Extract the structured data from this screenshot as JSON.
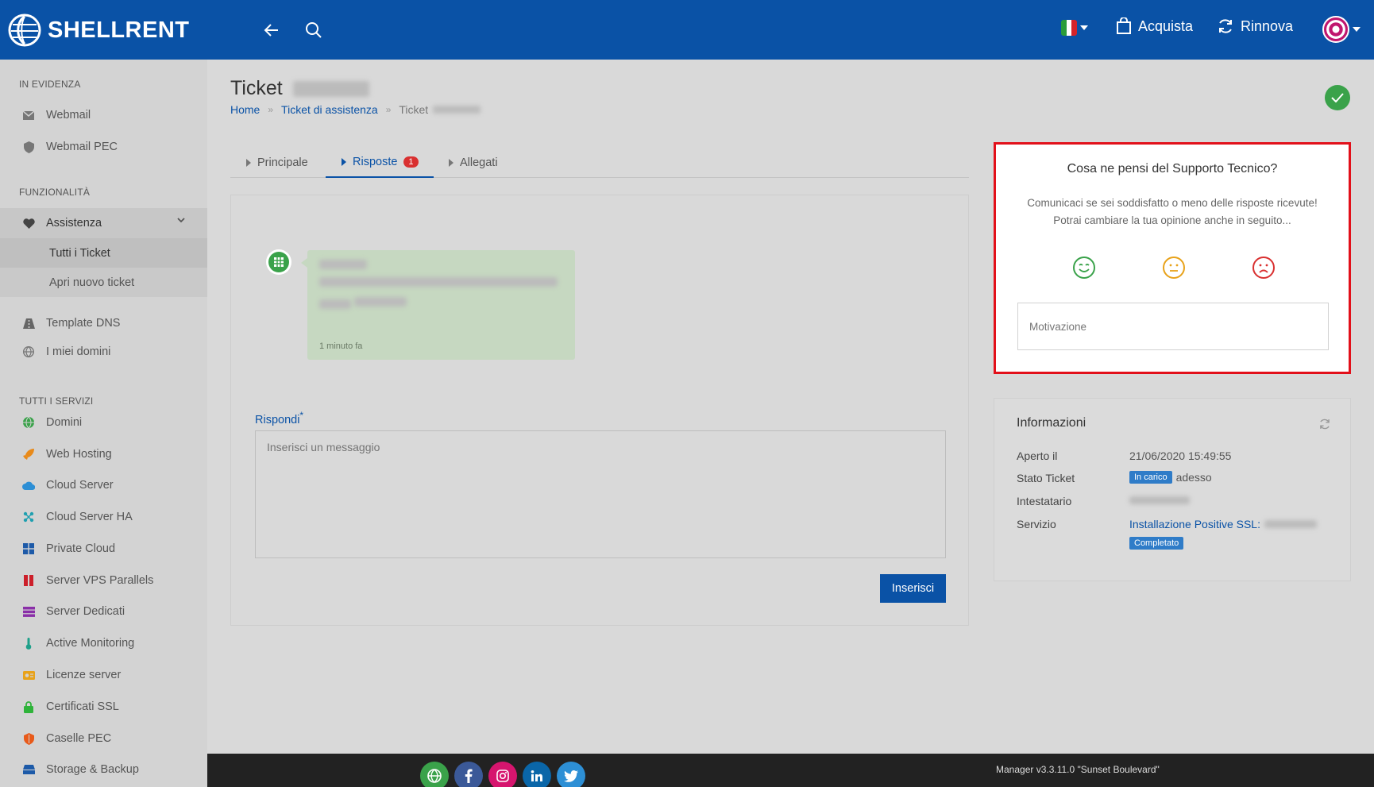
{
  "topbar": {
    "brand": "SHELLRENT",
    "buy_label": "Acquista",
    "renew_label": "Rinnova"
  },
  "sidebar": {
    "section_featured": "IN EVIDENZA",
    "webmail": "Webmail",
    "webmail_pec": "Webmail PEC",
    "section_features": "FUNZIONALITÀ",
    "assistenza": "Assistenza",
    "all_tickets": "Tutti i Ticket",
    "new_ticket": "Apri nuovo ticket",
    "dns_template": "Template DNS",
    "my_domains": "I miei domini",
    "section_services": "TUTTI I SERVIZI",
    "services": [
      {
        "label": "Domini",
        "icon": "globe-icon",
        "color": "#3aa24a"
      },
      {
        "label": "Web Hosting",
        "icon": "rocket-icon",
        "color": "#e88a1a"
      },
      {
        "label": "Cloud Server",
        "icon": "cloud-icon",
        "color": "#2d8fd5"
      },
      {
        "label": "Cloud Server HA",
        "icon": "network-icon",
        "color": "#20a0b0"
      },
      {
        "label": "Private Cloud",
        "icon": "windows-icon",
        "color": "#1d5aa8"
      },
      {
        "label": "Server VPS Parallels",
        "icon": "parallels-icon",
        "color": "#cc1f2a"
      },
      {
        "label": "Server Dedicati",
        "icon": "server-icon",
        "color": "#8a2fa8"
      },
      {
        "label": "Active Monitoring",
        "icon": "thermometer-icon",
        "color": "#1ea08a"
      },
      {
        "label": "Licenze server",
        "icon": "license-icon",
        "color": "#e8a21a"
      },
      {
        "label": "Certificati SSL",
        "icon": "lock-icon",
        "color": "#2fb33a"
      },
      {
        "label": "Caselle PEC",
        "icon": "shield-icon",
        "color": "#e85a1a"
      },
      {
        "label": "Storage & Backup",
        "icon": "storage-icon",
        "color": "#1d5aa8"
      }
    ]
  },
  "page": {
    "title": "Ticket",
    "breadcrumb_home": "Home",
    "breadcrumb_tickets": "Ticket di assistenza",
    "breadcrumb_current": "Ticket"
  },
  "tabs": {
    "principale": "Principale",
    "risposte": "Risposte",
    "risposte_badge": "1",
    "allegati": "Allegati"
  },
  "message": {
    "time": "1 minuto fa"
  },
  "reply": {
    "label": "Rispondi",
    "required_mark": "*",
    "placeholder": "Inserisci un messaggio",
    "submit": "Inserisci"
  },
  "feedback": {
    "title": "Cosa ne pensi del Supporto Tecnico?",
    "line1": "Comunicaci se sei soddisfatto o meno delle risposte ricevute!",
    "line2": "Potrai cambiare la tua opinione anche in seguito...",
    "placeholder": "Motivazione",
    "colors": {
      "happy": "#3aa24a",
      "neutral": "#e8a21a",
      "sad": "#d93030"
    }
  },
  "info": {
    "title": "Informazioni",
    "opened_label": "Aperto il",
    "opened_value": "21/06/2020 15:49:55",
    "status_label": "Stato Ticket",
    "status_pill": "In carico",
    "status_when": "adesso",
    "owner_label": "Intestatario",
    "service_label": "Servizio",
    "service_link": "Installazione Positive SSL:",
    "service_pill": "Completato"
  },
  "footer": {
    "version": "Manager v3.3.11.0 \"Sunset Boulevard\""
  }
}
